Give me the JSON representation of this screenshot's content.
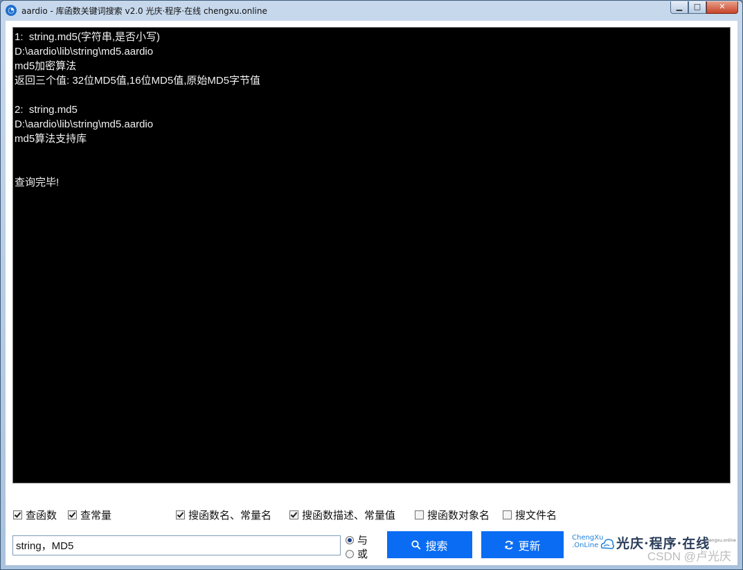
{
  "window": {
    "title": "aardio - 库函数关键词搜索 v2.0 光庆·程序·在线 chengxu.online",
    "minimize_label": "▁",
    "maximize_label": "□",
    "close_label": "✕"
  },
  "output": {
    "text": "1:  string.md5(字符串,是否小写)\nD:\\aardio\\lib\\string\\md5.aardio\nmd5加密算法\n返回三个值: 32位MD5值,16位MD5值,原始MD5字节值\n\n2:  string.md5\nD:\\aardio\\lib\\string\\md5.aardio\nmd5算法支持库\n\n\n查询完毕!"
  },
  "options": [
    {
      "label": "查函数",
      "checked": true
    },
    {
      "label": "查常量",
      "checked": true
    },
    {
      "label": "搜函数名、常量名",
      "checked": true
    },
    {
      "label": "搜函数描述、常量值",
      "checked": true
    },
    {
      "label": "搜函数对象名",
      "checked": false
    },
    {
      "label": "搜文件名",
      "checked": false
    }
  ],
  "search": {
    "value": "string，MD5"
  },
  "logic": [
    {
      "label": "与",
      "selected": true
    },
    {
      "label": "或",
      "selected": false
    }
  ],
  "buttons": {
    "search_label": "搜索",
    "refresh_label": "更新"
  },
  "logo": {
    "line1": "ChengXu",
    "line2": ".OnLine",
    "main": "光庆·程序·在线",
    "small": "chengxu.online"
  },
  "watermark": "CSDN @卢光庆",
  "colors": {
    "button": "#0a6cf2",
    "output_bg": "#000000"
  }
}
